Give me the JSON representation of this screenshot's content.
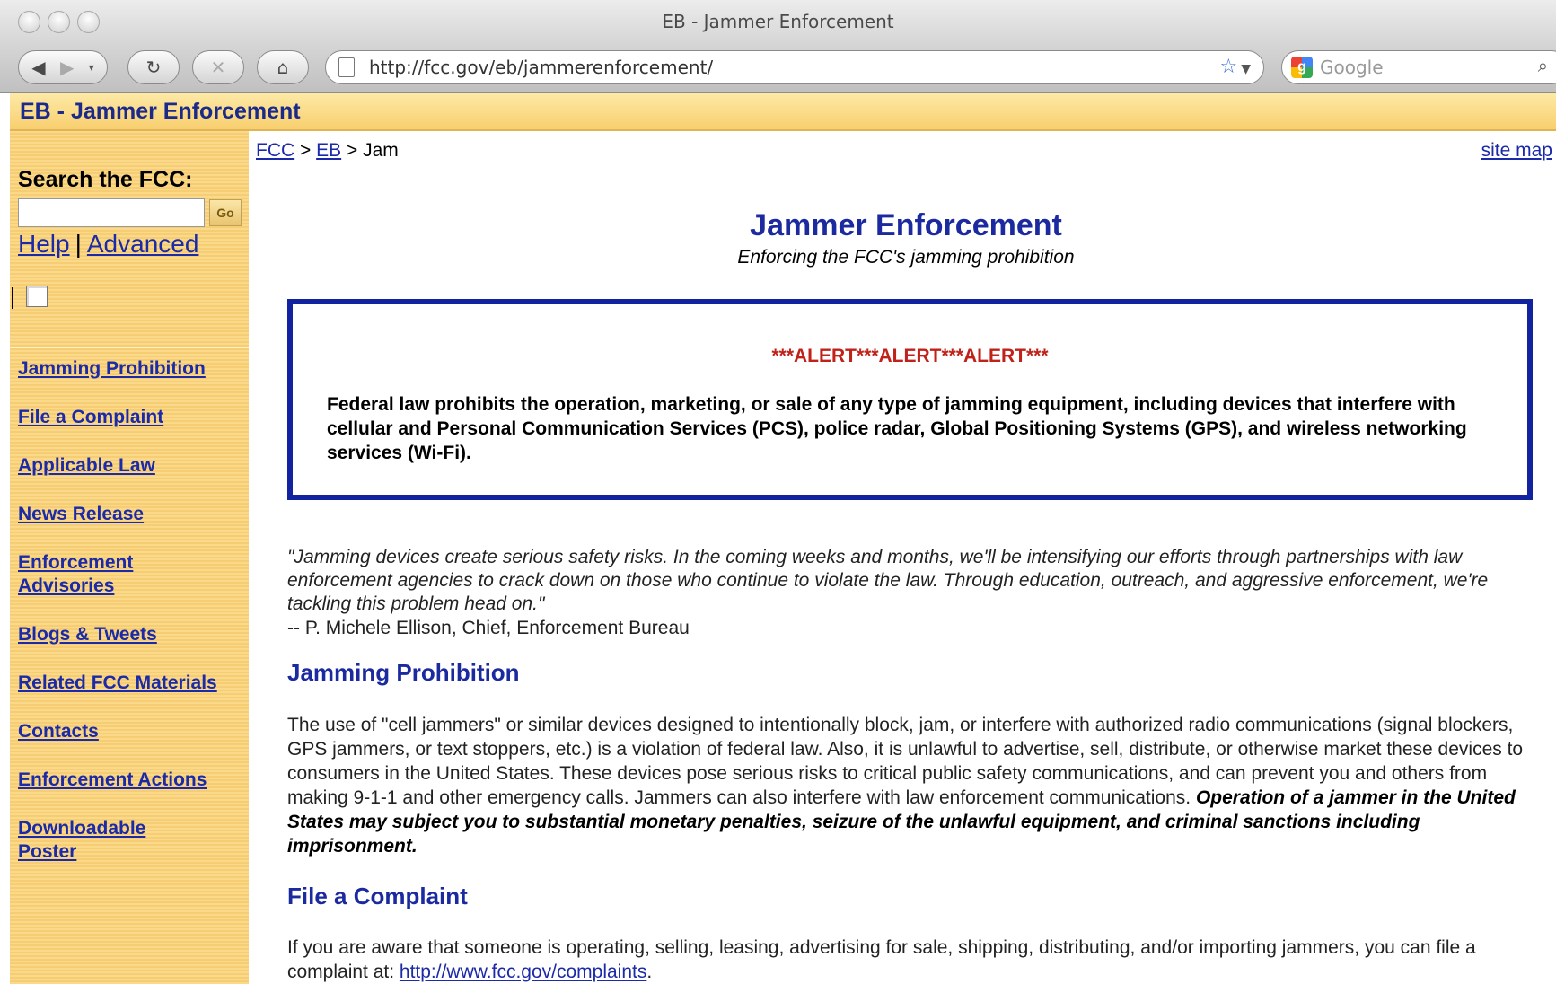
{
  "window": {
    "title": "EB - Jammer Enforcement"
  },
  "toolbar": {
    "url": "http://fcc.gov/eb/jammerenforcement/",
    "search_placeholder": "Google"
  },
  "header": {
    "title": "EB - Jammer Enforcement"
  },
  "sidebar": {
    "search_label": "Search the FCC:",
    "go_label": "Go",
    "help_label": "Help",
    "advanced_label": "Advanced",
    "nav": [
      {
        "label": "Jamming Prohibition"
      },
      {
        "label": "File a Complaint"
      },
      {
        "label": "Applicable Law"
      },
      {
        "label": "News Release"
      },
      {
        "label": "Enforcement Advisories"
      },
      {
        "label": "Blogs & Tweets"
      },
      {
        "label": "Related FCC Materials"
      },
      {
        "label": "Contacts"
      },
      {
        "label": "Enforcement Actions"
      },
      {
        "label": "Downloadable Poster"
      }
    ]
  },
  "breadcrumb": {
    "items": [
      "FCC",
      "EB",
      "Jam"
    ],
    "separator": ">",
    "site_map": "site map"
  },
  "main": {
    "title": "Jammer Enforcement",
    "subtitle": "Enforcing the FCC's jamming prohibition",
    "alert": {
      "heading": "***ALERT***ALERT***ALERT***",
      "body": "Federal law prohibits the operation, marketing, or sale of any type of jamming equipment, including devices that interfere with cellular and Personal Communication Services (PCS), police radar, Global Positioning Systems (GPS), and wireless networking services (Wi-Fi)."
    },
    "quote": "\"Jamming devices create serious safety risks. In the coming weeks and months, we'll be intensifying our efforts through partnerships with law enforcement agencies to crack down on those who continue to violate the law. Through education, outreach, and aggressive enforcement, we're tackling this problem head on.\"",
    "quote_attribution": "-- P. Michele Ellison, Chief, Enforcement Bureau",
    "sections": [
      {
        "title": "Jamming Prohibition",
        "text": "The use of \"cell jammers\" or similar devices designed to intentionally block, jam, or interfere with authorized radio communications (signal blockers, GPS jammers, or text stoppers, etc.) is a violation of federal law. Also, it is unlawful to advertise, sell, distribute, or otherwise market these devices to consumers in the United States. These devices pose serious risks to critical public safety communications, and can prevent you and others from making 9-1-1 and other emergency calls. Jammers can also interfere with law enforcement communications. ",
        "emphasis": "Operation of a jammer in the United States may subject you to substantial monetary penalties, seizure of the unlawful equipment, and criminal sanctions including imprisonment."
      },
      {
        "title": "File a Complaint",
        "text": "If you are aware that someone is operating, selling, leasing, advertising for sale, shipping, distributing, and/or importing jammers, you can file a complaint at: ",
        "link": "http://www.fcc.gov/complaints",
        "after_link": "."
      }
    ]
  },
  "colors": {
    "link": "#1b2aa8",
    "heading": "#1b2a9e",
    "alert_border": "#1223a0",
    "alert_text": "#c0221a",
    "sidebar_bg": "#f7cd74"
  }
}
